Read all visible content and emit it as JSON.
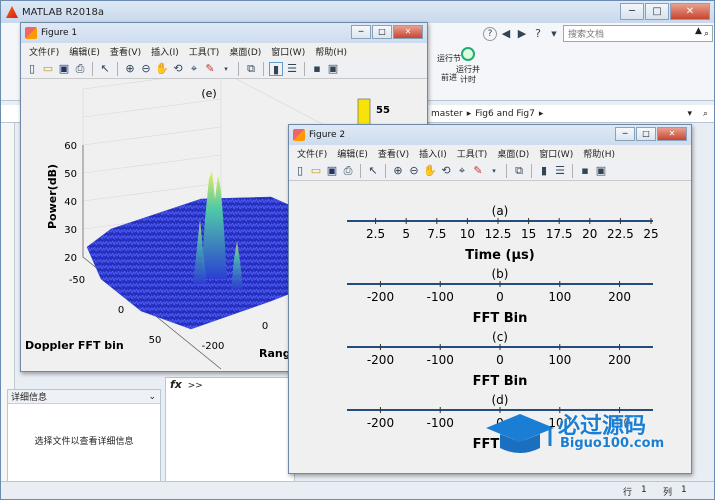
{
  "app": {
    "title": "MATLAB R2018a",
    "search_placeholder": "搜索文档",
    "ribbon": {
      "run_section": "运行节",
      "advance": "前进",
      "run_time": "运行并\n计时"
    },
    "path": {
      "part1": "master",
      "part2": "Fig6 and Fig7"
    },
    "details": {
      "header": "详细信息",
      "hint": "选择文件以查看详细信息"
    },
    "fx": "fx",
    "prompt": ">>",
    "status": {
      "row_label": "行",
      "row": "1",
      "col_label": "列",
      "col": "1"
    }
  },
  "figure1": {
    "title": "Figure 1",
    "menu": [
      "文件(F)",
      "编辑(E)",
      "查看(V)",
      "插入(I)",
      "工具(T)",
      "桌面(D)",
      "窗口(W)",
      "帮助(H)"
    ],
    "plot_title": "(e)",
    "zlabel": "Power(dB)",
    "zticks": [
      "60",
      "50",
      "40",
      "30",
      "20"
    ],
    "yticks": [
      "-50",
      "0",
      "50"
    ],
    "ylabel": "Doppler FFT bin",
    "xticks": [
      "-200",
      "0"
    ],
    "xlabel": "Range",
    "colorbar_tick": "55",
    "colorbar_color": "#f5e30a"
  },
  "figure2": {
    "title": "Figure 2",
    "menu": [
      "文件(F)",
      "编辑(E)",
      "查看(V)",
      "插入(I)",
      "工具(T)",
      "桌面(D)",
      "窗口(W)",
      "帮助(H)"
    ],
    "subplots": [
      {
        "title": "(a)",
        "ticks": [
          "2.5",
          "5",
          "7.5",
          "10",
          "12.5",
          "15",
          "17.5",
          "20",
          "22.5",
          "25"
        ],
        "xlabel": "Time (μs)"
      },
      {
        "title": "(b)",
        "ticks": [
          "-200",
          "-100",
          "0",
          "100",
          "200"
        ],
        "xlabel": "FFT Bin"
      },
      {
        "title": "(c)",
        "ticks": [
          "-200",
          "-100",
          "0",
          "100",
          "200"
        ],
        "xlabel": "FFT Bin"
      },
      {
        "title": "(d)",
        "ticks": [
          "-200",
          "-100",
          "0",
          "100",
          "200"
        ],
        "xlabel": "FFT Bin"
      }
    ]
  },
  "watermark": {
    "brand": "必过源码",
    "url": "Biguo100.com"
  }
}
